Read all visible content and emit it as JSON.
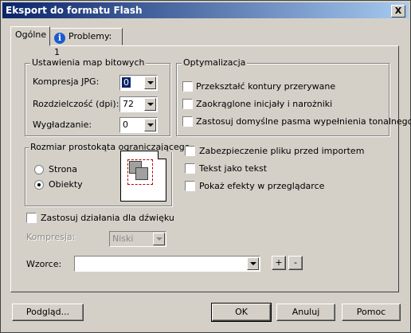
{
  "window": {
    "title": "Eksport do formatu Flash",
    "close_label": "X"
  },
  "tabs": [
    {
      "label": "Ogólne",
      "active": true
    },
    {
      "label": "Problemy: 1",
      "active": false,
      "icon": "info-icon"
    }
  ],
  "bitmap_group": {
    "title": "Ustawienia map bitowych",
    "jpg_label": "Kompresja JPG:",
    "jpg_value": "0",
    "dpi_label": "Rozdzielczość (dpi):",
    "dpi_value": "72",
    "smoothing_label": "Wygładzanie:",
    "smoothing_value": "0"
  },
  "optimization_group": {
    "title": "Optymalizacja",
    "options": [
      "Przekształć kontury przerywane",
      "Zaokrąglone inicjały i narożniki",
      "Zastosuj domyślne pasma wypełnienia tonalnego"
    ]
  },
  "bbox_group": {
    "title": "Rozmiar prostokąta ograniczającego",
    "options": [
      {
        "label": "Strona",
        "checked": false
      },
      {
        "label": "Obiekty",
        "checked": true
      }
    ]
  },
  "right_options": [
    "Zabezpieczenie pliku przed importem",
    "Tekst jako tekst",
    "Pokaż efekty w przeglądarce"
  ],
  "sound": {
    "label": "Zastosuj działania dla dźwięku",
    "compression_label": "Kompresja:",
    "compression_value": "Niski"
  },
  "patterns": {
    "label": "Wzorce:",
    "value": "",
    "add_label": "+",
    "remove_label": "-"
  },
  "buttons": {
    "preview": "Podgląd...",
    "ok": "OK",
    "cancel": "Anuluj",
    "help": "Pomoc"
  }
}
